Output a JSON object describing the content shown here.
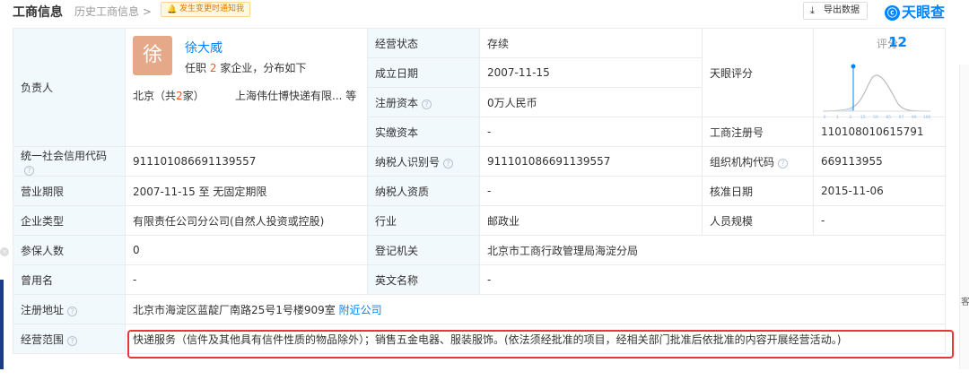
{
  "header": {
    "tab_active": "工商信息",
    "tab_history": "历史工商信息 >",
    "notify_label": "发生变更时通知我",
    "export_label": "导出数据",
    "brand": "天眼查"
  },
  "legal_rep": {
    "label": "负责人",
    "avatar_char": "徐",
    "name": "徐大威",
    "sub_prefix": "任职",
    "sub_count": "2",
    "sub_suffix": "家企业，分布如下",
    "loc_prefix": "北京（共",
    "loc_count": "2",
    "loc_suffix": "家）",
    "company": "上海伟仕博快递有限...  等"
  },
  "score": {
    "label": "天眼评分",
    "prefix": "评分",
    "value": "12",
    "ticks": [
      "0",
      "1",
      "3",
      "15",
      "50",
      "85",
      "97",
      "99",
      "100"
    ]
  },
  "rows": {
    "status_label": "经营状态",
    "status_value": "存续",
    "founded_label": "成立日期",
    "founded_value": "2007-11-15",
    "reg_capital_label": "注册资本",
    "reg_capital_value": "0万人民币",
    "paid_capital_label": "实缴资本",
    "paid_capital_value": "-",
    "reg_no_label": "工商注册号",
    "reg_no_value": "110108010615791",
    "credit_code_label": "统一社会信用代码",
    "credit_code_value": "911101086691139557",
    "taxpayer_id_label": "纳税人识别号",
    "taxpayer_id_value": "911101086691139557",
    "org_code_label": "组织机构代码",
    "org_code_value": "669113955",
    "term_label": "营业期限",
    "term_value": "2007-11-15 至 无固定期限",
    "taxpayer_qual_label": "纳税人资质",
    "taxpayer_qual_value": "-",
    "approve_date_label": "核准日期",
    "approve_date_value": "2015-11-06",
    "type_label": "企业类型",
    "type_value": "有限责任公司分公司(自然人投资或控股)",
    "industry_label": "行业",
    "industry_value": "邮政业",
    "staff_label": "人员规模",
    "staff_value": "-",
    "insured_label": "参保人数",
    "insured_value": "0",
    "authority_label": "登记机关",
    "authority_value": "北京市工商行政管理局海淀分局",
    "former_name_label": "曾用名",
    "former_name_value": "-",
    "en_name_label": "英文名称",
    "en_name_value": "-",
    "address_label": "注册地址",
    "address_value": "北京市海淀区蓝靛厂南路25号1号楼909室",
    "address_link": "附近公司",
    "scope_label": "经营范围",
    "scope_value": "快递服务（信件及其他具有信件性质的物品除外）；销售五金电器、服装服饰。(依法须经批准的项目，经相关部门批准后依批准的内容开展经营活动。)"
  },
  "edge": {
    "right_text": "客"
  },
  "colors": {
    "accent": "#0084ff",
    "label_bg": "#f2f9fc",
    "highlight": "#e53935"
  }
}
